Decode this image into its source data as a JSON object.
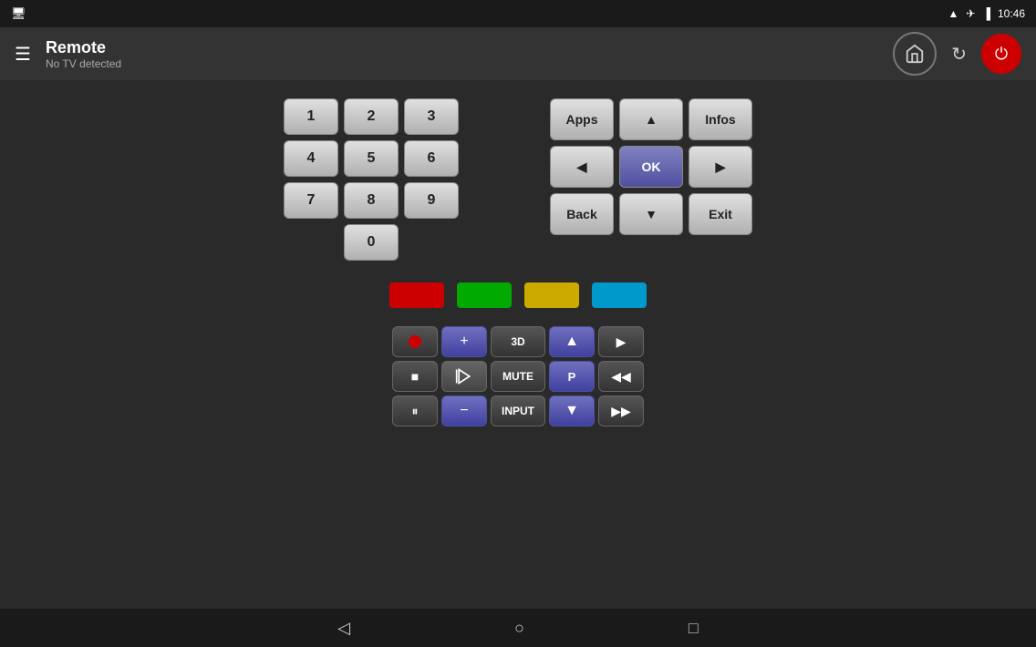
{
  "statusBar": {
    "time": "10:46",
    "wifiIcon": "wifi",
    "planeIcon": "airplane",
    "batteryIcon": "battery"
  },
  "topBar": {
    "title": "Remote",
    "subtitle": "No TV detected",
    "homeIcon": "home",
    "refreshIcon": "refresh",
    "powerIcon": "power",
    "menuIcon": "menu"
  },
  "numpad": {
    "keys": [
      "1",
      "2",
      "3",
      "4",
      "5",
      "6",
      "7",
      "8",
      "9",
      "0"
    ]
  },
  "navGrid": {
    "apps": "Apps",
    "up": "▲",
    "infos": "Infos",
    "left": "◀",
    "ok": "OK",
    "right": "▶",
    "back": "Back",
    "down": "▼",
    "exit": "Exit"
  },
  "colorButtons": {
    "red": "#cc0000",
    "green": "#00aa00",
    "yellow": "#ccaa00",
    "blue": "#0099cc"
  },
  "mediaControls": {
    "record": "●",
    "stop": "■",
    "pause": "⏸",
    "plus": "+",
    "minus": "−",
    "signal": "◁",
    "threeD": "3D",
    "mute": "MUTE",
    "input": "INPUT",
    "chUp": "▲",
    "chP": "P",
    "chDown": "▼",
    "play": "▶",
    "rewind": "◀◀",
    "fastForward": "▶▶"
  },
  "bottomNav": {
    "backIcon": "◁",
    "homeIcon": "○",
    "recentIcon": "□"
  }
}
